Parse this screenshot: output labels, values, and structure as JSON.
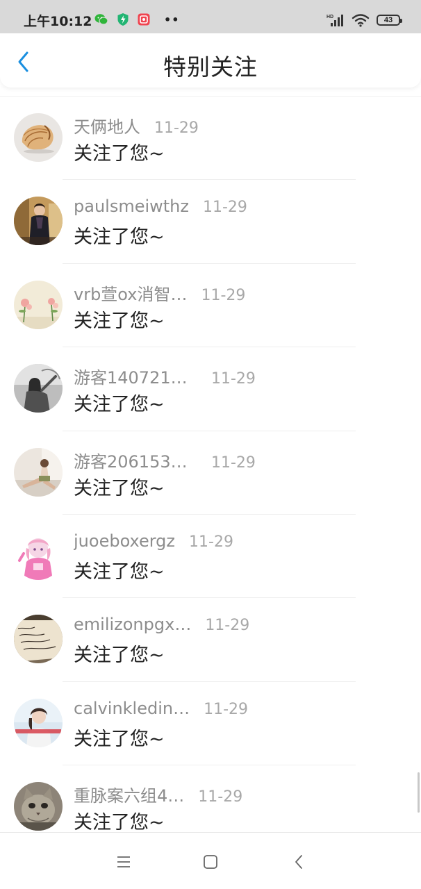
{
  "status_bar": {
    "time": "上午10:12",
    "battery": "43",
    "network": "HD",
    "more": "••"
  },
  "header": {
    "title": "特别关注"
  },
  "colors": {
    "accent": "#1a8fe0",
    "name_gray": "#8d8d8d",
    "date_gray": "#a8a8a8"
  },
  "items": [
    {
      "name": "天俩地人",
      "date": "11-29",
      "text": "关注了您~",
      "avatar": "nautilus-shell"
    },
    {
      "name": "paulsmeiwthz",
      "date": "11-29",
      "text": "关注了您~",
      "avatar": "woman-portrait"
    },
    {
      "name": "vrb萱ox消智…",
      "date": "11-29",
      "text": "关注了您~",
      "avatar": "flowers"
    },
    {
      "name": "游客1407216…",
      "date": "11-29",
      "text": "关注了您~",
      "avatar": "grayscale-girl"
    },
    {
      "name": "游客2061537…",
      "date": "11-29",
      "text": "关注了您~",
      "avatar": "sitting-woman"
    },
    {
      "name": "juoeboxergz",
      "date": "11-29",
      "text": "关注了您~",
      "avatar": "anime-girl"
    },
    {
      "name": "emilizonpgx…",
      "date": "11-29",
      "text": "关注了您~",
      "avatar": "handwriting-note"
    },
    {
      "name": "calvinkledin…",
      "date": "11-29",
      "text": "关注了您~",
      "avatar": "girl-with-caption"
    },
    {
      "name": "重脉案六组4…",
      "date": "11-29",
      "text": "关注了您~",
      "avatar": "cat"
    }
  ],
  "nav": {
    "menu": "menu-icon",
    "home": "home-icon",
    "back": "back-icon"
  }
}
